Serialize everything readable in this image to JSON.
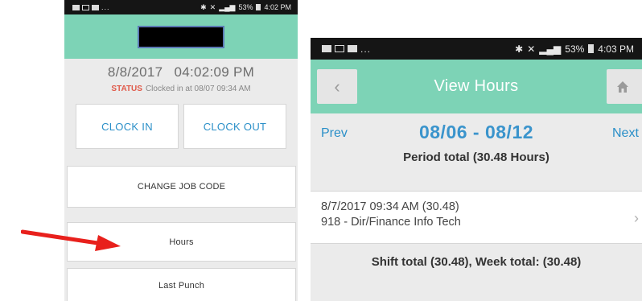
{
  "left_screen": {
    "status_bar": {
      "left_glyphs": "▣ ▣ ▣ ...",
      "right_text": "53%",
      "time": "4:02 PM"
    },
    "date": "8/8/2017",
    "time": "04:02:09 PM",
    "status_label": "STATUS",
    "status_text": "Clocked in at 08/07 09:34 AM",
    "clock_in_label": "CLOCK IN",
    "clock_out_label": "CLOCK OUT",
    "change_job_code_label": "CHANGE JOB CODE",
    "hours_label": "Hours",
    "last_punch_label": "Last Punch"
  },
  "right_screen": {
    "status_bar": {
      "right_text": "53%",
      "time": "4:03 PM"
    },
    "title": "View Hours",
    "prev_label": "Prev",
    "next_label": "Next",
    "date_range": "08/06 - 08/12",
    "period_total": "Period total (30.48 Hours)",
    "shift": {
      "line1": "8/7/2017 09:34 AM (30.48)",
      "line2": "918 - Dir/Finance Info Tech"
    },
    "shift_total": "Shift total (30.48), Week total: (30.48)"
  },
  "colors": {
    "header_teal": "#7dd3b6",
    "link_blue": "#2a8fc8",
    "status_red": "#e05a4a",
    "arrow_red": "#e8201c"
  },
  "icons": {
    "back": "chevron-left-icon",
    "home": "home-icon",
    "row_chevron": "chevron-right-icon",
    "annotation": "red-arrow-icon"
  }
}
